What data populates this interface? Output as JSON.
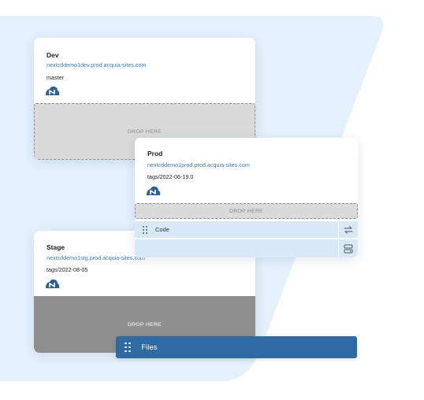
{
  "environments": {
    "dev": {
      "name": "Dev",
      "url": "nextcddemo1dev.prod.acquia-sites.com",
      "ref": "master",
      "drop_label": "DROP HERE"
    },
    "prod": {
      "name": "Prod",
      "url": "nextcddemo1prod.prod.acquia-sites.com",
      "ref": "tags/2022-06-19.0",
      "drop_label": "DROP HERE"
    },
    "stage": {
      "name": "Stage",
      "url": "nextcddemo1stg.prod.acquia-sites.com",
      "ref": "tags/2022-08-05",
      "drop_label": "DROP HERE"
    }
  },
  "rows": {
    "code_label": "Code"
  },
  "files_bar": {
    "label": "Files"
  },
  "colors": {
    "background_shape": "#e4f1fb",
    "link": "#3a7bb4",
    "files_bar": "#2f6aa0",
    "row_highlight": "#d8e8f6",
    "logo": "#2d5f93"
  },
  "icons": [
    "cloud-logo-icon",
    "drag-grip-icon",
    "swap-arrows-icon",
    "server-icon"
  ]
}
